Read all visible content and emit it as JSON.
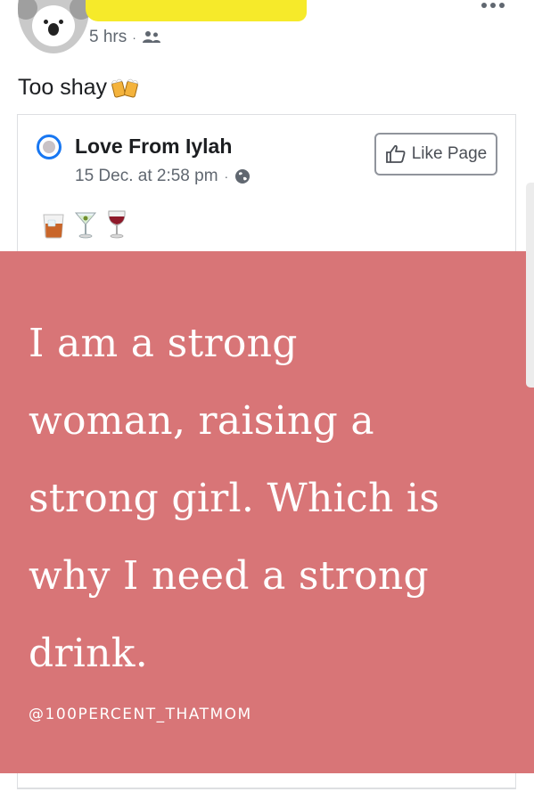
{
  "post": {
    "time": "5 hrs",
    "separator": "·",
    "audience_icon": "friends-icon",
    "text": "Too shay",
    "text_emoji": "beers-icon"
  },
  "shared": {
    "page_name": "Love From Iylah",
    "date": "15 Dec. at 2:58 pm",
    "separator": "·",
    "privacy_icon": "globe-icon",
    "like_button_label": "Like Page",
    "drinks": [
      "tumbler-glass-icon",
      "cocktail-glass-icon",
      "wine-glass-icon"
    ]
  },
  "quote": {
    "lines": [
      "I am a strong",
      "woman, raising a",
      "strong girl. Which is",
      "why I need a strong",
      "drink."
    ],
    "handle": "@100PERCENT_THATMOM",
    "background": "#d87577",
    "text_color": "#ffffff"
  },
  "colors": {
    "redaction": "#f6ea2a",
    "link_blue": "#1877f2",
    "meta_gray": "#606770"
  }
}
